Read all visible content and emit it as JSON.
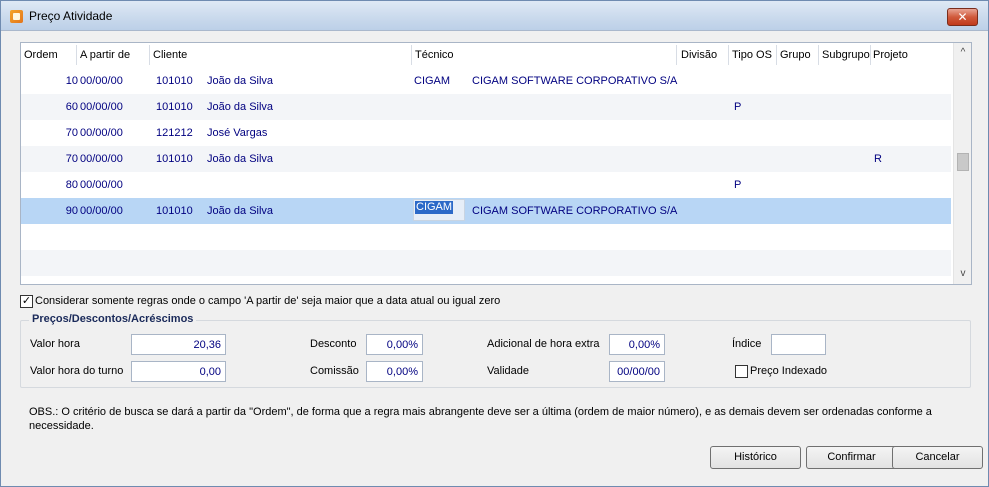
{
  "window": {
    "title": "Preço Atividade",
    "close_label": "✕"
  },
  "grid": {
    "columns": [
      "Ordem",
      "A partir de",
      "Cliente",
      "Técnico",
      "Divisão",
      "Tipo OS",
      "Grupo",
      "Subgrupo",
      "Projeto"
    ],
    "rows": [
      {
        "ordem": "10",
        "apartir": "00/00/00",
        "cli_cod": "101010",
        "cli_nome": "João da Silva",
        "tec_cod": "CIGAM",
        "tec_nome": "CIGAM SOFTWARE CORPORATIVO S/A",
        "tipo_os": "",
        "projeto": ""
      },
      {
        "ordem": "60",
        "apartir": "00/00/00",
        "cli_cod": "101010",
        "cli_nome": "João da Silva",
        "tec_cod": "",
        "tec_nome": "",
        "tipo_os": "P",
        "projeto": ""
      },
      {
        "ordem": "70",
        "apartir": "00/00/00",
        "cli_cod": "121212",
        "cli_nome": "José Vargas",
        "tec_cod": "",
        "tec_nome": "",
        "tipo_os": "",
        "projeto": ""
      },
      {
        "ordem": "70",
        "apartir": "00/00/00",
        "cli_cod": "101010",
        "cli_nome": "João da Silva",
        "tec_cod": "",
        "tec_nome": "",
        "tipo_os": "",
        "projeto": "R"
      },
      {
        "ordem": "80",
        "apartir": "00/00/00",
        "cli_cod": "",
        "cli_nome": "",
        "tec_cod": "",
        "tec_nome": "",
        "tipo_os": "P",
        "projeto": ""
      },
      {
        "ordem": "90",
        "apartir": "00/00/00",
        "cli_cod": "101010",
        "cli_nome": "João da Silva",
        "tec_cod": "CIGAM",
        "tec_nome": "CIGAM SOFTWARE CORPORATIVO S/A",
        "tipo_os": "",
        "projeto": ""
      }
    ],
    "selected_row": 5,
    "scroll_up": "^",
    "scroll_down": "v"
  },
  "options": {
    "consider_rule_label": "Considerar somente regras onde o campo 'A partir de' seja maior que a data atual ou igual zero",
    "consider_rule_checked": true,
    "check_glyph": "✓"
  },
  "prices": {
    "group_title": "Preços/Descontos/Acréscimos",
    "valor_hora_label": "Valor hora",
    "valor_hora": "20,36",
    "valor_hora_turno_label": "Valor hora do turno",
    "valor_hora_turno": "0,00",
    "desconto_label": "Desconto",
    "desconto": "0,00%",
    "comissao_label": "Comissão",
    "comissao": "0,00%",
    "adicional_label": "Adicional de hora extra",
    "adicional": "0,00%",
    "validade_label": "Validade",
    "validade": "00/00/00",
    "indice_label": "Índice",
    "indice": "",
    "preco_indexado_label": "Preço Indexado",
    "preco_indexado_checked": false
  },
  "obs": "OBS.: O critério de busca se dará a partir da \"Ordem\", de forma que a regra mais abrangente deve ser a última (ordem de maior número), e as demais devem ser ordenadas conforme a necessidade.",
  "buttons": {
    "historico": "Histórico",
    "confirmar": "Confirmar",
    "cancelar": "Cancelar"
  }
}
